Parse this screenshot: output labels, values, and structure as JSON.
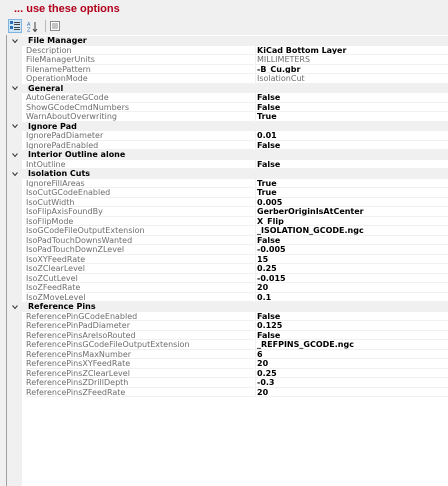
{
  "header": {
    "title": "... use these options"
  },
  "toolbar": {
    "buttons": [
      {
        "icon": "categorized-icon",
        "active": true
      },
      {
        "icon": "alphabetical-sort-icon",
        "active": false
      },
      {
        "icon": "property-pages-icon",
        "active": false
      }
    ]
  },
  "categories": [
    {
      "label": "File Manager",
      "expanded": true,
      "properties": [
        {
          "name": "Description",
          "value": "KiCad Bottom Layer",
          "bold": true,
          "dim": false
        },
        {
          "name": "FileManagerUnits",
          "value": "MILLIMETERS",
          "bold": false,
          "dim": true
        },
        {
          "name": "FilenamePattern",
          "value": "-B_Cu.gbr",
          "bold": true,
          "dim": false
        },
        {
          "name": "OperationMode",
          "value": "IsolationCut",
          "bold": false,
          "dim": true
        }
      ]
    },
    {
      "label": "General",
      "expanded": true,
      "properties": [
        {
          "name": "AutoGenerateGCode",
          "value": "False",
          "bold": true,
          "dim": false
        },
        {
          "name": "ShowGCodeCmdNumbers",
          "value": "False",
          "bold": true,
          "dim": false
        },
        {
          "name": "WarnAboutOverwriting",
          "value": "True",
          "bold": true,
          "dim": false
        }
      ]
    },
    {
      "label": "Ignore Pad",
      "expanded": true,
      "properties": [
        {
          "name": "IgnorePadDiameter",
          "value": "0.01",
          "bold": true,
          "dim": false
        },
        {
          "name": "IgnorePadEnabled",
          "value": "False",
          "bold": true,
          "dim": false
        }
      ]
    },
    {
      "label": "Interior Outline alone",
      "expanded": true,
      "properties": [
        {
          "name": "IntOutline",
          "value": "False",
          "bold": true,
          "dim": false
        }
      ]
    },
    {
      "label": "Isolation Cuts",
      "expanded": true,
      "properties": [
        {
          "name": "IgnoreFillAreas",
          "value": "True",
          "bold": true,
          "dim": false
        },
        {
          "name": "IsoCutGCodeEnabled",
          "value": "True",
          "bold": true,
          "dim": false
        },
        {
          "name": "IsoCutWidth",
          "value": "0.005",
          "bold": true,
          "dim": false
        },
        {
          "name": "IsoFlipAxisFoundBy",
          "value": "GerberOriginIsAtCenter",
          "bold": true,
          "dim": false
        },
        {
          "name": "IsoFlipMode",
          "value": "X_Flip",
          "bold": true,
          "dim": false
        },
        {
          "name": "IsoGCodeFileOutputExtension",
          "value": "_ISOLATION_GCODE.ngc",
          "bold": true,
          "dim": false
        },
        {
          "name": "IsoPadTouchDownsWanted",
          "value": "False",
          "bold": true,
          "dim": false
        },
        {
          "name": "IsoPadTouchDownZLevel",
          "value": "-0.005",
          "bold": true,
          "dim": false
        },
        {
          "name": "IsoXYFeedRate",
          "value": "15",
          "bold": true,
          "dim": false
        },
        {
          "name": "IsoZClearLevel",
          "value": "0.25",
          "bold": true,
          "dim": false
        },
        {
          "name": "IsoZCutLevel",
          "value": "-0.015",
          "bold": true,
          "dim": false
        },
        {
          "name": "IsoZFeedRate",
          "value": "20",
          "bold": true,
          "dim": false
        },
        {
          "name": "IsoZMoveLevel",
          "value": "0.1",
          "bold": true,
          "dim": false
        }
      ]
    },
    {
      "label": "Reference Pins",
      "expanded": true,
      "properties": [
        {
          "name": "ReferencePinGCodeEnabled",
          "value": "False",
          "bold": true,
          "dim": false
        },
        {
          "name": "ReferencePinPadDiameter",
          "value": "0.125",
          "bold": true,
          "dim": false
        },
        {
          "name": "ReferencePinsAreIsoRouted",
          "value": "False",
          "bold": true,
          "dim": false
        },
        {
          "name": "ReferencePinsGCodeFileOutputExtension",
          "value": "_REFPINS_GCODE.ngc",
          "bold": true,
          "dim": false
        },
        {
          "name": "ReferencePinsMaxNumber",
          "value": "6",
          "bold": true,
          "dim": false
        },
        {
          "name": "ReferencePinsXYFeedRate",
          "value": "20",
          "bold": true,
          "dim": false
        },
        {
          "name": "ReferencePinsZClearLevel",
          "value": "0.25",
          "bold": true,
          "dim": false
        },
        {
          "name": "ReferencePinsZDrillDepth",
          "value": "-0.3",
          "bold": true,
          "dim": false
        },
        {
          "name": "ReferencePinsZFeedRate",
          "value": "20",
          "bold": true,
          "dim": false
        }
      ]
    }
  ]
}
